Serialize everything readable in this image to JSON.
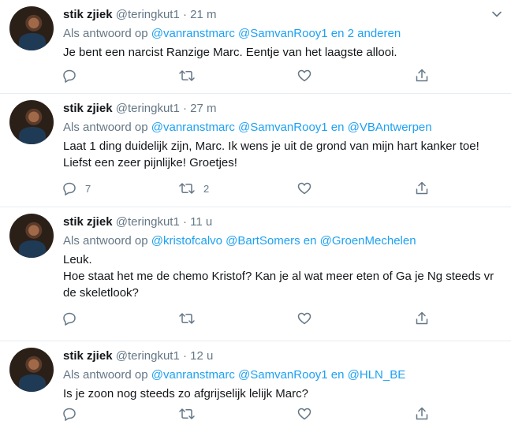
{
  "tweets": [
    {
      "name": "stik zjiek",
      "handle": "@teringkut1",
      "dot": "·",
      "time": "21 m",
      "reply_prefix": "Als antwoord op",
      "reply_mentions": "@vanranstmarc @SamvanRooy1 en 2 anderen",
      "text": "Je bent een narcist Ranzige Marc. Eentje van het laagste allooi.",
      "reply_count": "",
      "retweet_count": ""
    },
    {
      "name": "stik zjiek",
      "handle": "@teringkut1",
      "dot": "·",
      "time": "27 m",
      "reply_prefix": "Als antwoord op",
      "reply_mentions": "@vanranstmarc @SamvanRooy1 en @VBAntwerpen",
      "text": "Laat 1 ding duidelijk zijn, Marc. Ik wens je uit de grond van mijn hart kanker toe! Liefst een zeer pijnlijke! Groetjes!",
      "reply_count": "7",
      "retweet_count": "2"
    },
    {
      "name": "stik zjiek",
      "handle": "@teringkut1",
      "dot": "·",
      "time": "11 u",
      "reply_prefix": "Als antwoord op",
      "reply_mentions": "@kristofcalvo @BartSomers en @GroenMechelen",
      "text_line1": "Leuk.",
      "text_line2": "Hoe staat het me de chemo Kristof? Kan je al wat meer eten of Ga je Ng steeds vr de skeletlook?",
      "reply_count": "",
      "retweet_count": ""
    },
    {
      "name": "stik zjiek",
      "handle": "@teringkut1",
      "dot": "·",
      "time": "12 u",
      "reply_prefix": "Als antwoord op",
      "reply_mentions": "@vanranstmarc @SamvanRooy1 en @HLN_BE",
      "text": "Is je zoon nog steeds zo afgrijselijk lelijk Marc?",
      "reply_count": "",
      "retweet_count": ""
    }
  ],
  "icons": {
    "more": "chevron-down-icon",
    "reply": "reply-icon",
    "retweet": "retweet-icon",
    "like": "heart-icon",
    "share": "share-icon"
  },
  "colors": {
    "link": "#1da1f2",
    "secondary": "#657786",
    "text": "#14171a",
    "divider": "#e6ecf0"
  }
}
